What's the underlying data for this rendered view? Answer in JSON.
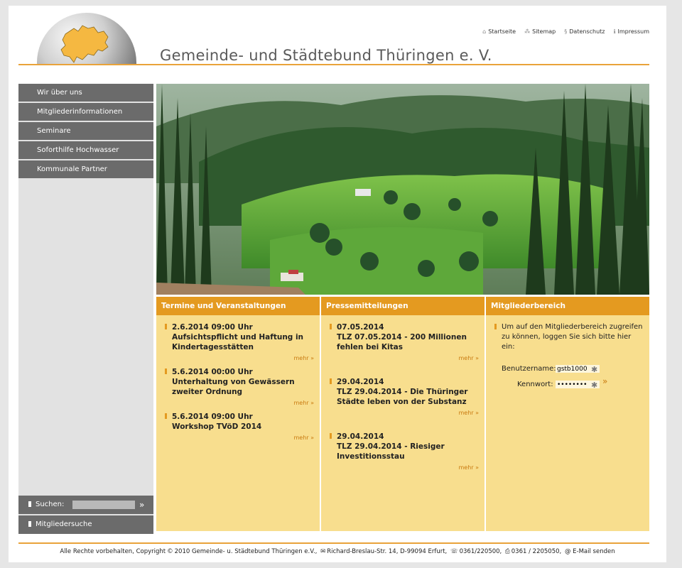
{
  "header": {
    "title": "Gemeinde- und Städtebund Thüringen e. V.",
    "links": [
      {
        "label": "Startseite",
        "icon": "home-icon"
      },
      {
        "label": "Sitemap",
        "icon": "sitemap-icon"
      },
      {
        "label": "Datenschutz",
        "icon": "paragraph-icon"
      },
      {
        "label": "Impressum",
        "icon": "info-icon"
      }
    ]
  },
  "nav": {
    "items": [
      "Wir über uns",
      "Mitgliederinformationen",
      "Seminare",
      "Soforthilfe Hochwasser",
      "Kommunale Partner"
    ],
    "search_label": "Suchen:",
    "search_value": "",
    "member_search": "Mitgliedersuche"
  },
  "columns": {
    "events": {
      "title": "Termine und Veranstaltungen",
      "entries": [
        {
          "line1": "2.6.2014 09:00 Uhr",
          "line2": "Aufsichtspflicht und Haftung in Kindertagesstätten",
          "more": "mehr"
        },
        {
          "line1": "5.6.2014 00:00 Uhr",
          "line2": "Unterhaltung von Gewässern zweiter Ordnung",
          "more": "mehr"
        },
        {
          "line1": "5.6.2014 09:00 Uhr",
          "line2": "Workshop TVöD 2014",
          "more": "mehr"
        }
      ]
    },
    "press": {
      "title": "Pressemitteilungen",
      "entries": [
        {
          "line1": "07.05.2014",
          "line2": "TLZ 07.05.2014 - 200 Millionen fehlen bei Kitas",
          "more": "mehr"
        },
        {
          "line1": "29.04.2014",
          "line2": "TLZ 29.04.2014 - Die Thüringer Städte leben von der Substanz",
          "more": "mehr"
        },
        {
          "line1": "29.04.2014",
          "line2": "TLZ 29.04.2014 - Riesiger Investitionsstau",
          "more": "mehr"
        }
      ]
    },
    "members": {
      "title": "Mitgliederbereich",
      "text": "Um auf den Mitgliederbereich zugreifen zu können, loggen Sie sich bitte hier ein:",
      "username_label": "Benutzername:",
      "username_value": "gstb1000",
      "password_label": "Kennwort:",
      "password_value": "12345678"
    }
  },
  "footer": {
    "rights": "Alle Rechte vorbehalten, Copyright",
    "copyright_symbol": "©",
    "year_org": "2010  Gemeinde- u. Städtebund Thüringen e.V.,",
    "address": "Richard-Breslau-Str. 14, D-99094 Erfurt,",
    "phone": "0361/220500,",
    "fax": "0361 / 2205050,",
    "email": "@ E-Mail senden"
  },
  "colors": {
    "accent": "#e49a20",
    "panel": "#f8de8e",
    "nav": "#6b6b6b"
  }
}
